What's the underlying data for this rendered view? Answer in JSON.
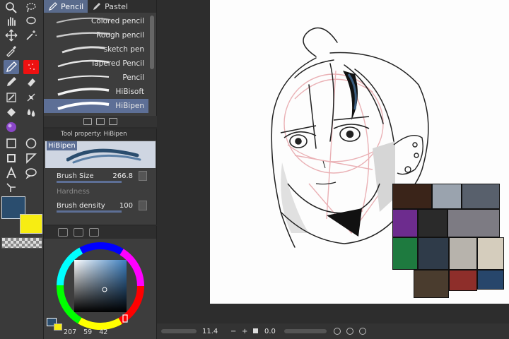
{
  "brush_tabs": [
    {
      "label": "Pencil",
      "icon": "pencil-icon",
      "active": true
    },
    {
      "label": "Pastel",
      "icon": "pastel-icon",
      "active": false
    }
  ],
  "brush_list": [
    {
      "label": "Colored pencil",
      "selected": false
    },
    {
      "label": "Rough pencil",
      "selected": false
    },
    {
      "label": "sketch pen",
      "selected": false
    },
    {
      "label": "Tapered Pencil",
      "selected": false
    },
    {
      "label": "Pencil",
      "selected": false
    },
    {
      "label": "HiBisoft",
      "selected": false
    },
    {
      "label": "HiBipen",
      "selected": true
    }
  ],
  "tool_property": {
    "header": "Tool property: HiBipen",
    "brush_name": "HiBipen",
    "brush_size_label": "Brush Size",
    "brush_size_value": "266.8",
    "hardness_label": "Hardness",
    "brush_density_label": "Brush density",
    "brush_density_value": "100"
  },
  "colors": {
    "main": "#2a4d6e",
    "sub": "#f7ed12",
    "accent": "#5d6f96"
  },
  "hsv": {
    "h": "207",
    "s": "59",
    "v": "42"
  },
  "status_bar": {
    "zoom": "11.4",
    "minus": "−",
    "plus": "+",
    "rotate": "0.0"
  }
}
